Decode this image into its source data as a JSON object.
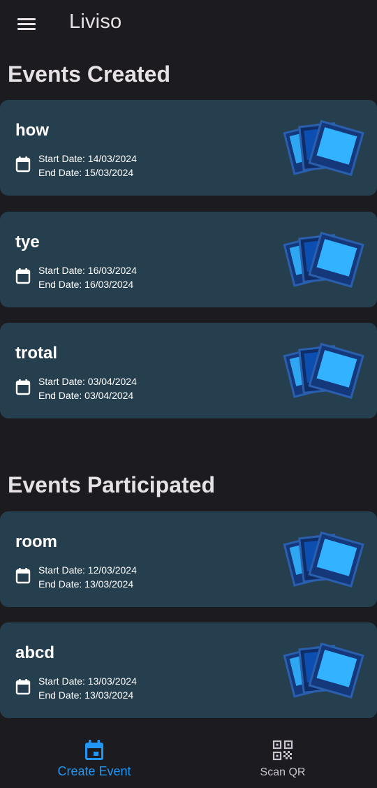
{
  "app": {
    "title": "Liviso"
  },
  "sections": {
    "created_title": "Events Created",
    "participated_title": "Events Participated"
  },
  "events_created": [
    {
      "name": "how",
      "start": "Start Date: 14/03/2024",
      "end": "End Date: 15/03/2024"
    },
    {
      "name": "tye",
      "start": "Start Date: 16/03/2024",
      "end": "End Date: 16/03/2024"
    },
    {
      "name": "trotal",
      "start": "Start Date: 03/04/2024",
      "end": "End Date: 03/04/2024"
    }
  ],
  "events_participated": [
    {
      "name": "room",
      "start": "Start Date: 12/03/2024",
      "end": "End Date: 13/03/2024"
    },
    {
      "name": "abcd",
      "start": "Start Date: 13/03/2024",
      "end": "End Date: 13/03/2024"
    }
  ],
  "bottom_nav": {
    "create_label": "Create Event",
    "scan_label": "Scan QR",
    "active": "create"
  },
  "icons": {
    "menu": "menu-icon",
    "calendar": "calendar-icon",
    "photos": "photo-stack-icon",
    "create": "event-calendar-icon",
    "scan": "qr-code-icon"
  },
  "colors": {
    "background": "#1c1b1f",
    "card": "#263f4f",
    "accent": "#2196f3",
    "text": "#e6e1e5"
  }
}
